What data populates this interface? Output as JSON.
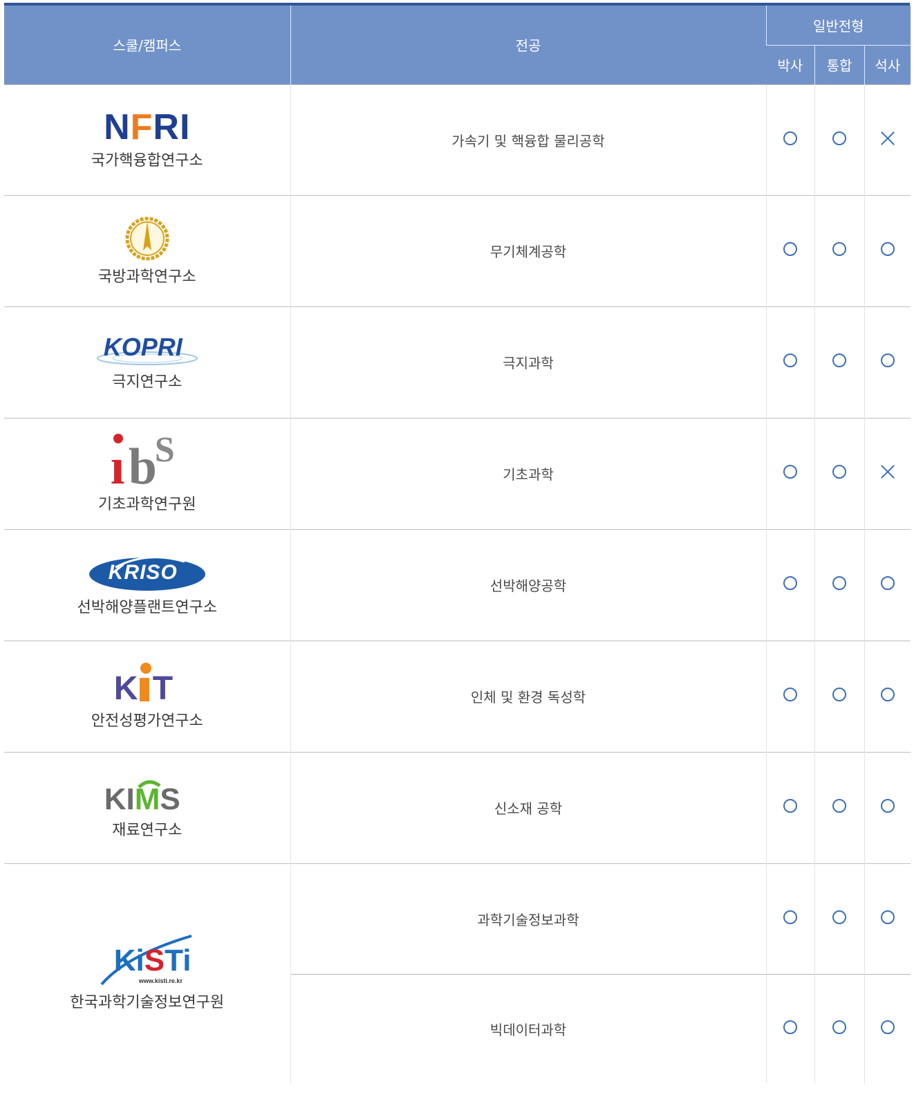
{
  "header": {
    "school": "스쿨/캠퍼스",
    "major": "전공",
    "general": "일반전형",
    "phd": "박사",
    "integrated": "통합",
    "masters": "석사"
  },
  "rows": [
    {
      "logo": "NFRI",
      "institute": "국가핵융합연구소",
      "majors": [
        {
          "name": "가속기 및 핵융합 물리공학",
          "phd": "○",
          "integrated": "○",
          "masters": "×"
        }
      ]
    },
    {
      "logo": "add-emblem",
      "institute": "국방과학연구소",
      "majors": [
        {
          "name": "무기체계공학",
          "phd": "○",
          "integrated": "○",
          "masters": "○"
        }
      ]
    },
    {
      "logo": "KOPRI",
      "institute": "극지연구소",
      "majors": [
        {
          "name": "극지과학",
          "phd": "○",
          "integrated": "○",
          "masters": "○"
        }
      ]
    },
    {
      "logo": "ibs",
      "institute": "기초과학연구원",
      "majors": [
        {
          "name": "기초과학",
          "phd": "○",
          "integrated": "○",
          "masters": "×"
        }
      ]
    },
    {
      "logo": "KRISO",
      "institute": "선박해양플랜트연구소",
      "majors": [
        {
          "name": "선박해양공학",
          "phd": "○",
          "integrated": "○",
          "masters": "○"
        }
      ]
    },
    {
      "logo": "KIT",
      "institute": "안전성평가연구소",
      "majors": [
        {
          "name": "인체 및 환경 독성학",
          "phd": "○",
          "integrated": "○",
          "masters": "○"
        }
      ]
    },
    {
      "logo": "KIMS",
      "institute": "재료연구소",
      "majors": [
        {
          "name": "신소재 공학",
          "phd": "○",
          "integrated": "○",
          "masters": "○"
        }
      ]
    },
    {
      "logo": "KiSTi",
      "logo_url": "www.kisti.re.kr",
      "institute": "한국과학기술정보연구원",
      "majors": [
        {
          "name": "과학기술정보과학",
          "phd": "○",
          "integrated": "○",
          "masters": "○"
        },
        {
          "name": "빅데이터과학",
          "phd": "○",
          "integrated": "○",
          "masters": "○"
        }
      ]
    }
  ],
  "colors": {
    "header_bg": "#7192c8",
    "top_rule": "#2f5596",
    "mark": "#3b6fb6"
  }
}
